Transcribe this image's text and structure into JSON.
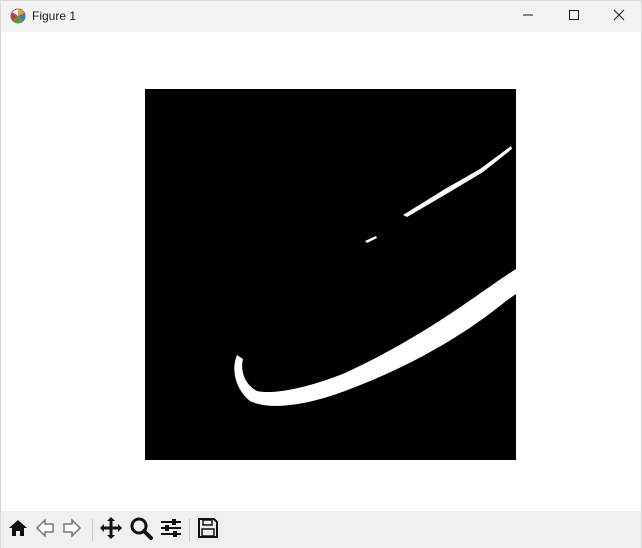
{
  "window": {
    "title": "Figure 1"
  },
  "icons": {
    "app": "matplotlib-figure-icon",
    "minimize": "minimize-icon",
    "maximize": "maximize-icon",
    "close": "close-icon"
  },
  "toolbar": {
    "buttons": [
      {
        "name": "home",
        "icon": "home-icon"
      },
      {
        "name": "back",
        "icon": "back-arrow-icon"
      },
      {
        "name": "forward",
        "icon": "forward-arrow-icon"
      },
      {
        "name": "pan",
        "icon": "move-icon"
      },
      {
        "name": "zoom",
        "icon": "magnifier-icon"
      },
      {
        "name": "configure",
        "icon": "sliders-icon"
      },
      {
        "name": "save",
        "icon": "floppy-disk-icon"
      }
    ]
  },
  "image": {
    "background": "#000000",
    "foreground": "#ffffff",
    "description_colors": [
      "#000000",
      "#ffffff"
    ]
  }
}
